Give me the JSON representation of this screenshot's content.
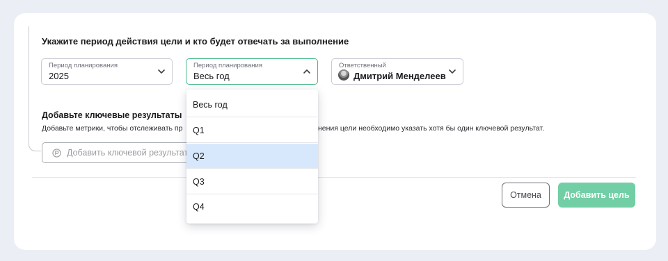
{
  "form": {
    "section_title": "Укажите период действия цели и кто будет отвечать за выполнение",
    "year_field": {
      "label": "Период планирования",
      "value": "2025"
    },
    "period_field": {
      "label": "Период планирования",
      "value": "Весь год"
    },
    "responsible_field": {
      "label": "Ответственный",
      "value": "Дмитрий Менделеев"
    }
  },
  "key_results": {
    "title": "Добавьте ключевые результаты",
    "description_left": "Добавьте метрики, чтобы отслеживать пр",
    "description_right": "нения цели необходимо указать хотя бы один ключевой результат.",
    "add_button_label": "Добавить ключевой результат"
  },
  "dropdown": {
    "options": [
      "Весь год",
      "Q1",
      "Q2",
      "Q3",
      "Q4"
    ],
    "highlighted": "Q2"
  },
  "footer": {
    "cancel_label": "Отмена",
    "submit_label": "Добавить цель"
  },
  "colors": {
    "accent": "#49b98a",
    "submit_bg": "#72cfa5",
    "highlight": "#d8e8fc"
  }
}
